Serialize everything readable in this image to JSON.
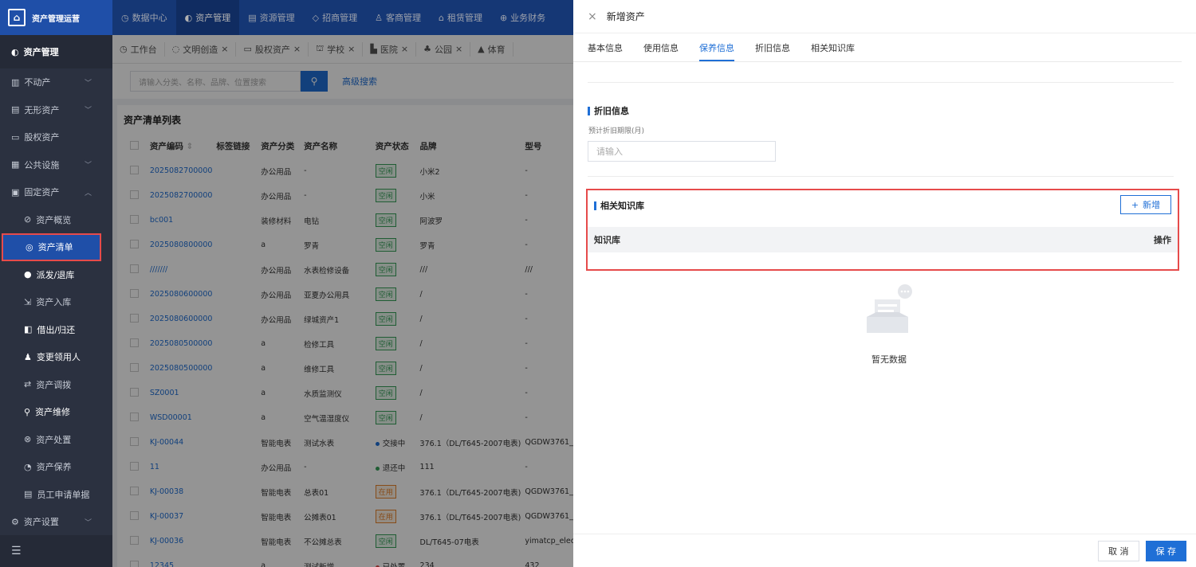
{
  "app": {
    "title": "资产管理运营"
  },
  "topnav": [
    "数据中心",
    "资产管理",
    "资源管理",
    "招商管理",
    "客商管理",
    "租赁管理",
    "业务财务"
  ],
  "sidebar": {
    "header": "资产管理",
    "items": [
      {
        "label": "不动产",
        "expand": "﹀"
      },
      {
        "label": "无形资产",
        "expand": "﹀"
      },
      {
        "label": "股权资产",
        "expand": ""
      },
      {
        "label": "公共设施",
        "expand": "﹀"
      },
      {
        "label": "固定资产",
        "expand": "︿"
      }
    ],
    "sub_items": [
      "资产概览",
      "资产清单",
      "派发/退库",
      "资产入库",
      "借出/归还",
      "变更领用人",
      "资产调拨",
      "资产维修",
      "资产处置",
      "资产保养",
      "员工申请单据"
    ],
    "last_item": {
      "label": "资产设置",
      "expand": "﹀"
    }
  },
  "tabs": [
    "工作台",
    "文明创造",
    "股权资产",
    "学校",
    "医院",
    "公园",
    "体育"
  ],
  "search": {
    "placeholder": "请输入分类、名称、品牌、位置搜索",
    "advanced": "高级搜索"
  },
  "list": {
    "title": "资产清单列表",
    "columns": [
      "资产编码",
      "标签链接",
      "资产分类",
      "资产名称",
      "资产状态",
      "品牌",
      "型号"
    ],
    "rows": [
      [
        "2025082700000",
        "",
        "办公用品",
        "-",
        "空闲",
        "小米2",
        "-"
      ],
      [
        "2025082700000",
        "",
        "办公用品",
        "-",
        "空闲",
        "小米",
        "-"
      ],
      [
        "bc001",
        "",
        "装修材料",
        "电钻",
        "空闲",
        "阿波罗",
        "-"
      ],
      [
        "2025080800000",
        "",
        "a",
        "罗青",
        "空闲",
        "罗青",
        "-"
      ],
      [
        "///////",
        "",
        "办公用品",
        "水表检修设备",
        "空闲",
        "///",
        "///"
      ],
      [
        "2025080600000",
        "",
        "办公用品",
        "亚夏办公用具",
        "空闲",
        "/",
        "-"
      ],
      [
        "2025080600000",
        "",
        "办公用品",
        "绿城资产1",
        "空闲",
        "/",
        "-"
      ],
      [
        "2025080500000",
        "",
        "a",
        "检修工具",
        "空闲",
        "/",
        "-"
      ],
      [
        "2025080500000",
        "",
        "a",
        "维修工具",
        "空闲",
        "/",
        "-"
      ],
      [
        "SZ0001",
        "",
        "a",
        "水质监测仪",
        "空闲",
        "/",
        "-"
      ],
      [
        "WSD00001",
        "",
        "a",
        "空气温湿度仪",
        "空闲",
        "/",
        "-"
      ],
      [
        "KJ-00044",
        "",
        "智能电表",
        "测试水表",
        "交接中",
        "376.1（DL/T645-2007电表)",
        "QGDW3761_"
      ],
      [
        "11",
        "",
        "办公用品",
        "-",
        "退还中",
        "111",
        "-"
      ],
      [
        "KJ-00038",
        "",
        "智能电表",
        "总表01",
        "在用",
        "376.1（DL/T645-2007电表)",
        "QGDW3761_"
      ],
      [
        "KJ-00037",
        "",
        "智能电表",
        "公摊表01",
        "在用",
        "376.1（DL/T645-2007电表)",
        "QGDW3761_"
      ],
      [
        "KJ-00036",
        "",
        "智能电表",
        "不公摊总表",
        "空闲",
        "DL/T645-07电表",
        "yimatcp_elec"
      ],
      [
        "12345",
        "",
        "a",
        "测试新增",
        "已处置",
        "234",
        "432"
      ]
    ]
  },
  "drawer": {
    "title": "新增资产",
    "tabs": [
      "基本信息",
      "使用信息",
      "保养信息",
      "折旧信息",
      "相关知识库"
    ],
    "active_tab": "保养信息",
    "depreciation": {
      "title": "折旧信息",
      "field_label": "预计折旧期限(月)",
      "placeholder": "请输入"
    },
    "knowledge": {
      "title": "相关知识库",
      "add_button": "新增",
      "col_name": "知识库",
      "col_action": "操作"
    },
    "empty_text": "暂无数据",
    "cancel": "取 消",
    "save": "保 存"
  },
  "colors": {
    "primary": "#1f6fd6",
    "topbar": "#1f4fa8",
    "sidebar": "#2b3140",
    "highlight": "#e64b4b"
  }
}
